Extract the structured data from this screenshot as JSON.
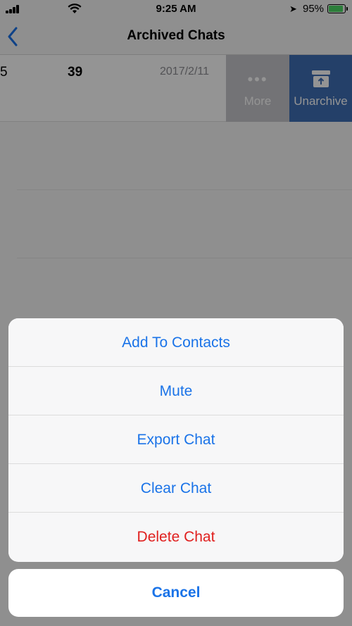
{
  "status_bar": {
    "time": "9:25 AM",
    "battery_percent": "95%",
    "icons": [
      "signal-icon",
      "wifi-icon",
      "location-icon",
      "battery-charging-icon"
    ]
  },
  "nav": {
    "title": "Archived Chats",
    "back_icon": "chevron-left-icon"
  },
  "chat_row": {
    "name_fragment": "39",
    "left_fragment": "5",
    "date": "2017/2/11",
    "actions": {
      "more_label": "More",
      "more_icon": "ellipsis-icon",
      "unarchive_label": "Unarchive",
      "unarchive_icon": "unarchive-box-icon"
    }
  },
  "action_sheet": {
    "items": [
      {
        "label": "Add To Contacts"
      },
      {
        "label": "Mute"
      },
      {
        "label": "Export Chat"
      },
      {
        "label": "Clear Chat"
      },
      {
        "label": "Delete Chat"
      }
    ],
    "cancel_label": "Cancel"
  },
  "colors": {
    "accent": "#1a73e8",
    "destructive": "#e0201f",
    "unarchive_bg": "#3f6fb6",
    "more_bg": "#c7c7cc"
  }
}
